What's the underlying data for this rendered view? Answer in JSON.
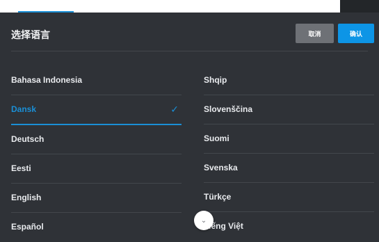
{
  "dialog": {
    "title": "选择语言",
    "cancel_label": "取消",
    "confirm_label": "确认"
  },
  "languages_left": [
    {
      "label": "Bahasa Indonesia",
      "selected": false
    },
    {
      "label": "Dansk",
      "selected": true
    },
    {
      "label": "Deutsch",
      "selected": false
    },
    {
      "label": "Eesti",
      "selected": false
    },
    {
      "label": "English",
      "selected": false
    },
    {
      "label": "Español",
      "selected": false
    }
  ],
  "languages_right": [
    {
      "label": "Shqip",
      "selected": false
    },
    {
      "label": "Slovenščina",
      "selected": false
    },
    {
      "label": "Suomi",
      "selected": false
    },
    {
      "label": "Svenska",
      "selected": false
    },
    {
      "label": "Türkçe",
      "selected": false
    },
    {
      "label": "Tiếng Việt",
      "selected": false
    }
  ],
  "icons": {
    "check": "check-icon",
    "scroll": "chevron-down-icon"
  },
  "colors": {
    "accent": "#1a8fd6",
    "background": "#2f3237",
    "cancel_button": "#6e7176",
    "confirm_button": "#0d95e6"
  }
}
